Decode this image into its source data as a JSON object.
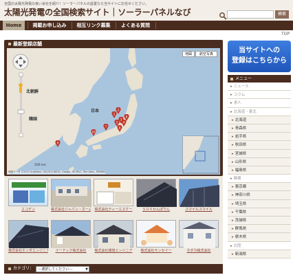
{
  "header": {
    "tagline": "全国の太陽光発電の良い会社を紹介！ソーラーパネルの設置なら当サイトにお任せください。",
    "title": "太陽光発電の全国検索サイト｜ソーラーパネルなび",
    "search_button": "検索",
    "search_placeholder": ""
  },
  "nav": {
    "items": [
      "Home",
      "掲載お申し込み",
      "相互リンク募集",
      "よくある質問"
    ]
  },
  "top_link": "TOP",
  "map_panel": {
    "title": "最新登録店舗",
    "btn_map": "地図",
    "btn_satellite": "航空写真",
    "labels": {
      "north_korea": "北朝鮮",
      "korea": "韓国",
      "japan": "日本"
    },
    "attribution": "地図データ ©2013 AutoNavi, GS(2011)6020, Google, SK M&C, Tele Atlas, ZENRIN",
    "scale": "200 km",
    "pins": [
      "1",
      "2",
      "3",
      "4",
      "5",
      "6",
      "7",
      "8",
      "9",
      "10"
    ]
  },
  "companies": [
    {
      "name": "エコデン"
    },
    {
      "name": "株式会社ジャパン・ホームサービス"
    },
    {
      "name": "株式会社ティーエスケー"
    },
    {
      "name": "ＳＯＳかんぽでん"
    },
    {
      "name": "スマイルスマイル"
    },
    {
      "name": "株式会社ホンダエンジニア"
    },
    {
      "name": "イーテック株式会社"
    },
    {
      "name": "株式会社環境エンジニア"
    },
    {
      "name": "株式会社サンセイー"
    },
    {
      "name": "ホダカ株式会社"
    }
  ],
  "category": {
    "label": "カテゴリ：",
    "selected": "---選択してください---"
  },
  "sidebar": {
    "cta_line1": "当サイトへの",
    "cta_line2": "登録はこちらから",
    "menu_title": "メニュー",
    "items": [
      {
        "label": "ニュース",
        "group": true
      },
      {
        "label": "コラム",
        "group": true
      },
      {
        "label": "求人",
        "group": true
      },
      {
        "label": "北海道・東北",
        "group": true
      },
      {
        "label": "北海道",
        "group": false
      },
      {
        "label": "青森県",
        "group": false
      },
      {
        "label": "岩手県",
        "group": false
      },
      {
        "label": "秋田県",
        "group": false
      },
      {
        "label": "宮城県",
        "group": false
      },
      {
        "label": "山形県",
        "group": false
      },
      {
        "label": "福島県",
        "group": false
      },
      {
        "label": "関東",
        "group": true
      },
      {
        "label": "東京都",
        "group": false
      },
      {
        "label": "神奈川県",
        "group": false
      },
      {
        "label": "埼玉県",
        "group": false
      },
      {
        "label": "千葉県",
        "group": false
      },
      {
        "label": "茨城県",
        "group": false
      },
      {
        "label": "群馬県",
        "group": false
      },
      {
        "label": "栃木県",
        "group": false
      },
      {
        "label": "北陸",
        "group": true
      },
      {
        "label": "新潟県",
        "group": false
      }
    ]
  },
  "colors": {
    "nav_bg": "#4a2c1f",
    "accent_blue": "#2a66cc",
    "pin_red": "#c0392b"
  }
}
